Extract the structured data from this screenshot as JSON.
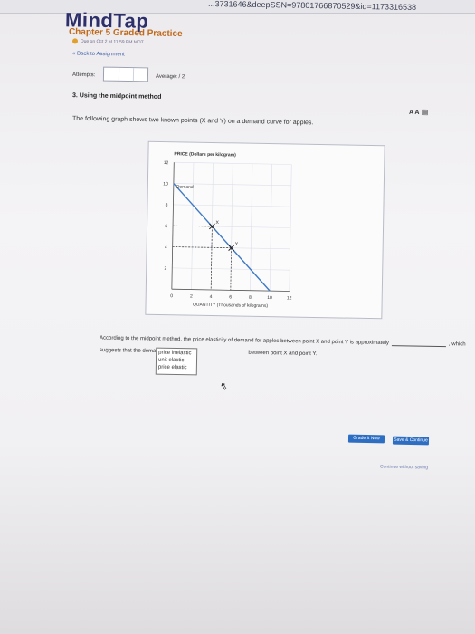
{
  "browser": {
    "url": "...3731646&deepSSN=97801766870529&id=1173316538"
  },
  "app": {
    "brand": "MindTap"
  },
  "header": {
    "chapter_title": "Chapter 5 Graded Practice",
    "due_text": "Due on Oct 2 at 11:59 PM MDT",
    "back_link": "Back to Assignment"
  },
  "attempts": {
    "label": "Attempts:",
    "average_label": "Average:",
    "average_value": "/ 2"
  },
  "question": {
    "number_title": "3.  Using the midpoint method",
    "font_tools": "A A",
    "prompt": "The following graph shows two known points (X and Y) on a demand curve for apples."
  },
  "chart_data": {
    "type": "line",
    "ylabel": "PRICE (Dollars per kilogram)",
    "xlabel": "QUANTITY (Thousands of kilograms)",
    "xlim": [
      0,
      12
    ],
    "ylim": [
      0,
      12
    ],
    "x_ticks": [
      "0",
      "2",
      "4",
      "6",
      "8",
      "10",
      "12"
    ],
    "y_ticks": [
      "0",
      "2",
      "4",
      "6",
      "8",
      "10",
      "12"
    ],
    "series": [
      {
        "name": "Demand",
        "x": [
          0,
          10
        ],
        "y": [
          10,
          0
        ]
      }
    ],
    "points": [
      {
        "label": "X",
        "x": 4,
        "y": 6
      },
      {
        "label": "Y",
        "x": 6,
        "y": 4
      }
    ]
  },
  "answer": {
    "sentence_start": "According to the midpoint method, the price elasticity of demand for apples between point X and point Y is approximately",
    "sentence_end": ", which",
    "line2_start": "suggests that the demand for apples is",
    "line2_end": "between point X and point Y.",
    "dropdown_options": [
      "price inelastic",
      "unit elastic",
      "price elastic"
    ]
  },
  "buttons": {
    "grade": "Grade It Now",
    "save": "Save & Continue",
    "continue": "Continue without saving"
  }
}
